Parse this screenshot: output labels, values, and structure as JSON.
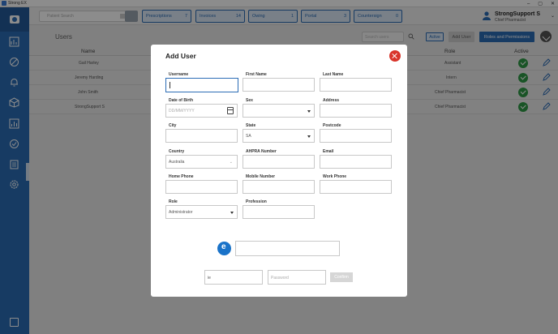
{
  "window": {
    "title": "Strong EX",
    "controls": [
      "–",
      "▢",
      "✕"
    ]
  },
  "topbar": {
    "search_placeholder": "Patient Search",
    "tabs": [
      {
        "label": "Prescriptions",
        "count": "7"
      },
      {
        "label": "Invoices",
        "count": "14"
      },
      {
        "label": "Owing",
        "count": "1"
      },
      {
        "label": "Portal",
        "count": "3"
      },
      {
        "label": "Countersign",
        "count": "0"
      }
    ],
    "user": {
      "name": "StrongSupport S",
      "role": "Chief Pharmacist"
    }
  },
  "page": {
    "title": "Users",
    "search_placeholder": "Search users",
    "active_label": "Active",
    "add_user_label": "Add User",
    "roles_label": "Roles and Permissions"
  },
  "table": {
    "headers": {
      "name": "Name",
      "role": "Role",
      "active": "Active"
    },
    "rows": [
      {
        "name": "Gail Harley",
        "role": "Assistant"
      },
      {
        "name": "Jeremy Harding",
        "role": "Intern"
      },
      {
        "name": "John Smith",
        "role": "Chief Pharmacist"
      },
      {
        "name": "StrongSupport S",
        "role": "Chief Pharmacist"
      }
    ]
  },
  "modal": {
    "title": "Add User",
    "fields": {
      "username": {
        "label": "Username",
        "value": ""
      },
      "first_name": {
        "label": "First Name",
        "value": ""
      },
      "last_name": {
        "label": "Last Name",
        "value": ""
      },
      "dob": {
        "label": "Date of Birth",
        "placeholder": "DD/MM/YYYY"
      },
      "sex": {
        "label": "Sex",
        "value": ""
      },
      "address": {
        "label": "Address",
        "value": ""
      },
      "city": {
        "label": "City",
        "value": ""
      },
      "state": {
        "label": "State",
        "value": "SA"
      },
      "postcode": {
        "label": "Postcode",
        "value": ""
      },
      "country": {
        "label": "Country",
        "value": "Australia"
      },
      "ahpra": {
        "label": "AHPRA Number",
        "value": ""
      },
      "email": {
        "label": "Email",
        "value": ""
      },
      "home_phone": {
        "label": "Home Phone",
        "value": ""
      },
      "mobile": {
        "label": "Mobile Number",
        "value": ""
      },
      "work_phone": {
        "label": "Work Phone",
        "value": ""
      },
      "role": {
        "label": "Role",
        "value": "Administrator"
      },
      "profession": {
        "label": "Profession",
        "value": ""
      }
    },
    "bottom": {
      "small_input_value": "ie",
      "password_placeholder": "Password",
      "confirm_label": "Confirm"
    }
  },
  "colors": {
    "accent": "#2b6cb5",
    "close": "#d9352b",
    "active": "#2e9a45"
  }
}
